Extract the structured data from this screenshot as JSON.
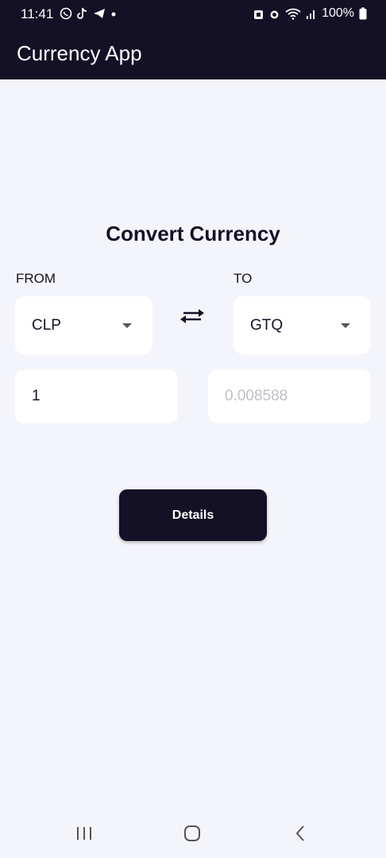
{
  "status_bar": {
    "time": "11:41",
    "battery": "100%",
    "left_icons": [
      "whatsapp-icon",
      "tiktok-icon",
      "telegram-icon",
      "dot-icon"
    ],
    "right_icons": [
      "vpn-icon",
      "alarm-icon",
      "wifi-icon",
      "signal-icon",
      "battery-icon"
    ]
  },
  "app_bar": {
    "title": "Currency App"
  },
  "converter": {
    "heading": "Convert Currency",
    "from_label": "FROM",
    "to_label": "TO",
    "from_currency": "CLP",
    "to_currency": "GTQ",
    "from_amount": "1",
    "to_amount": "0.008588",
    "swap_icon": "swap-arrows-icon",
    "details_label": "Details"
  },
  "nav_bar": {
    "buttons": [
      "recents-icon",
      "home-icon",
      "back-icon"
    ]
  },
  "colors": {
    "primary": "#141126",
    "background": "#f4f5fa",
    "card": "#ffffff"
  }
}
